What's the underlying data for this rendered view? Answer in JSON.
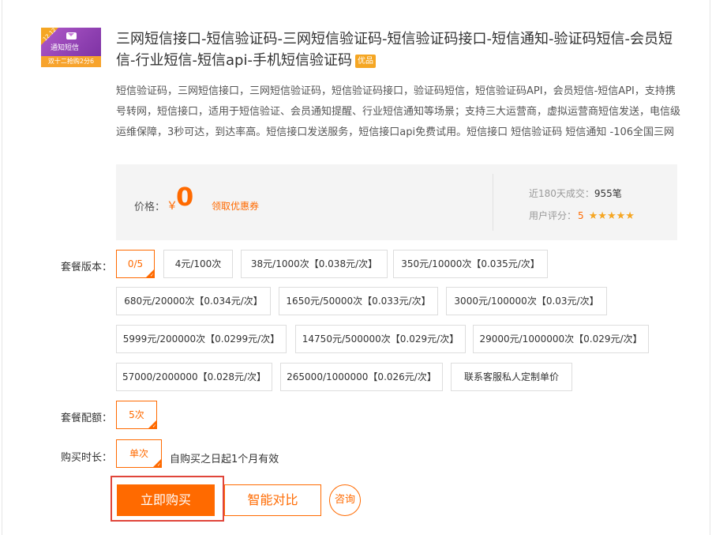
{
  "thumbnail": {
    "corner_tag": "12.12",
    "label": "通知短信",
    "bottom_text": "双十二抢购2分6"
  },
  "product": {
    "title": "三网短信接口-短信验证码-三网短信验证码-短信验证码接口-短信通知-验证码短信-会员短信-行业短信-短信api-手机短信验证码",
    "badge": "优品",
    "description": "短信验证码，三网短信接口，三网短信验证码，短信验证码接口，验证码短信，短信验证码API，会员短信-短信API，支持携号转网，短信接口，适用于短信验证、会员通知提醒、行业短信通知等场景；支持三大运营商，虚拟运营商短信发送，电信级运维保障，3秒可达，到达率高。短信接口发送服务，短信接口api免费试用。短信接口 短信验证码 短信通知 -106全国三网"
  },
  "price": {
    "label": "价格：",
    "currency": "￥",
    "value": "0",
    "coupon_link": "领取优惠券"
  },
  "stats": {
    "sales_label": "近180天成交：",
    "sales_value": "955笔",
    "rating_label": "用户评分：",
    "rating_value": "5",
    "stars": 5
  },
  "package": {
    "label": "套餐版本：",
    "options": [
      "0/5",
      "4元/100次",
      "38元/1000次【0.038元/次】",
      "350元/10000次【0.035元/次】",
      "680元/20000次【0.034元/次】",
      "1650元/50000次【0.033元/次】",
      "3000元/100000次【0.03元/次】",
      "5999元/200000次【0.0299元/次】",
      "14750元/500000次【0.029元/次】",
      "29000元/1000000次【0.029元/次】",
      "57000/2000000【0.028元/次】",
      "265000/1000000【0.026元/次】",
      "联系客服私人定制单价"
    ],
    "selected": "0/5"
  },
  "config": {
    "label": "套餐配额：",
    "value": "5次"
  },
  "duration": {
    "label": "购买时长：",
    "value": "单次",
    "note": "自购买之日起1个月有效"
  },
  "actions": {
    "buy": "立即购买",
    "compare": "智能对比",
    "consult": "咨询"
  },
  "colors": {
    "accent": "#ff6a00",
    "highlight_border": "#e0453a",
    "badge": "#f5a623"
  }
}
